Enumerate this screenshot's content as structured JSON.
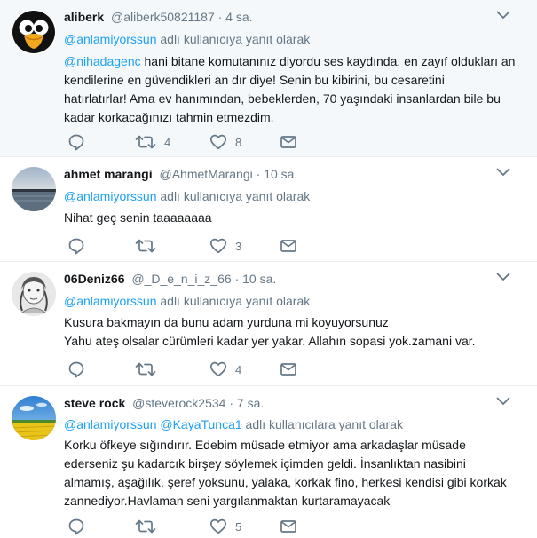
{
  "colors": {
    "link": "#1da1f2",
    "muted": "#657786",
    "text": "#14171a",
    "divider": "#e6ecf0",
    "highlight_bg": "#f5f8fa"
  },
  "tweets": [
    {
      "name": "aliberk",
      "handle": "@aliberk50821187",
      "sep": "·",
      "time": "4 sa.",
      "reply_mentions": "@anlamiyorssun",
      "reply_text": " adlı kullanıcıya yanıt olarak",
      "body_mention": "@nihadagenc",
      "body_lines": [
        " hani bitane komutanınız diyordu ses kaydında, en zayıf oldukları an",
        "kendilerine en güvendikleri an dır diye! Senin bu kibirini, bu cesaretini",
        "hatırlatırlar! Ama ev hanımından, bebeklerden, 70 yaşındaki insanlardan bile bu",
        "kadar korkacağınızı tahmin etmezdim."
      ],
      "retweets": "4",
      "likes": "8",
      "avatar_icon": "penguin-icon"
    },
    {
      "name": "ahmet marangi",
      "handle": "@AhmetMarangi",
      "sep": "·",
      "time": "10 sa.",
      "reply_mentions": "@anlamiyorssun",
      "reply_text": " adlı kullanıcıya yanıt olarak",
      "body_lines": [
        "Nihat geç senin taaaaaaaa"
      ],
      "retweets": "",
      "likes": "3",
      "avatar_icon": "lake-sunset-icon"
    },
    {
      "name": "06Deniz66",
      "handle": "@_D_e_n_i_z_66",
      "sep": "·",
      "time": "10 sa.",
      "reply_mentions": "@anlamiyorssun",
      "reply_text": " adlı kullanıcıya yanıt olarak",
      "body_lines": [
        "Kusura bakmayın da bunu adam yurduna mi koyuyorsunuz",
        "Yahu ateş olsalar cürümleri kadar yer yakar. Allahın sopasi yok.zamani var."
      ],
      "retweets": "",
      "likes": "4",
      "avatar_icon": "sketch-portrait-icon"
    },
    {
      "name": "steve rock",
      "handle": "@steverock2534",
      "sep": "·",
      "time": "7 sa.",
      "reply_mentions": "@anlamiyorssun @KayaTunca1",
      "reply_text": " adlı kullanıcılara yanıt olarak",
      "body_lines": [
        "Korku öfkeye sığındırır. Edebim müsade etmiyor ama arkadaşlar müsade",
        "ederseniz şu kadarcık birşey söylemek içimden geldi. İnsanlıktan nasibini",
        "almamış, aşağılık, şeref yoksunu, yalaka, korkak fino, herkesi kendisi gibi korkak",
        "zannediyor.Havlaman seni yargılanmaktan kurtaramayacak"
      ],
      "retweets": "",
      "likes": "5",
      "avatar_icon": "field-landscape-icon"
    }
  ]
}
